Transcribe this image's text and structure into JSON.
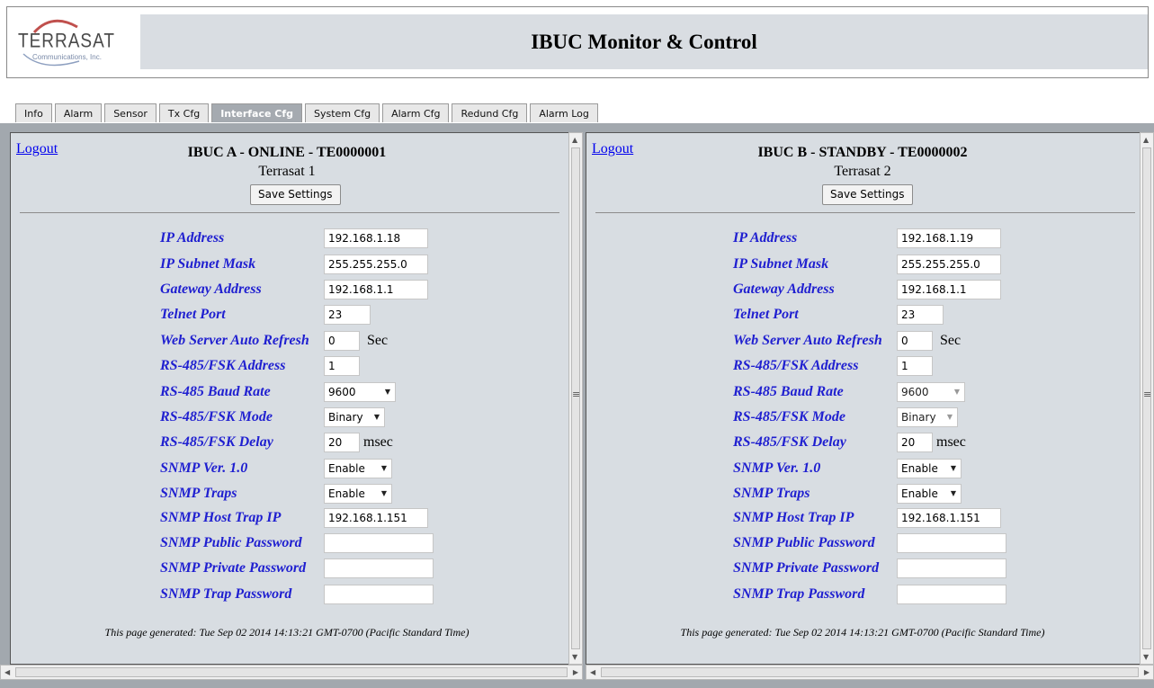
{
  "header": {
    "logo_name": "TERRASAT",
    "logo_sub": "Communications, Inc.",
    "title": "IBUC Monitor & Control"
  },
  "tabs": [
    {
      "label": "Info"
    },
    {
      "label": "Alarm"
    },
    {
      "label": "Sensor"
    },
    {
      "label": "Tx Cfg"
    },
    {
      "label": "Interface Cfg",
      "active": true
    },
    {
      "label": "System Cfg"
    },
    {
      "label": "Alarm Cfg"
    },
    {
      "label": "Redund Cfg"
    },
    {
      "label": "Alarm Log"
    }
  ],
  "labels": {
    "ip": "IP Address",
    "mask": "IP Subnet Mask",
    "gateway": "Gateway Address",
    "telnet": "Telnet Port",
    "refresh": "Web Server Auto Refresh",
    "rs485_addr": "RS-485/FSK Address",
    "baud": "RS-485 Baud Rate",
    "mode": "RS-485/FSK Mode",
    "delay": "RS-485/FSK Delay",
    "snmp_ver": "SNMP Ver. 1.0",
    "traps": "SNMP Traps",
    "host_trap": "SNMP Host Trap IP",
    "public_pw": "SNMP Public Password",
    "private_pw": "SNMP Private Password",
    "trap_pw": "SNMP Trap Password",
    "sec": "Sec",
    "msec": "msec"
  },
  "panels": [
    {
      "logout": "Logout",
      "title": "IBUC A - ONLINE - TE0000001",
      "name": "Terrasat 1",
      "save": "Save Settings",
      "ip": "192.168.1.18",
      "mask": "255.255.255.0",
      "gateway": "192.168.1.1",
      "telnet": "23",
      "refresh": "0",
      "rs485_addr": "1",
      "baud": "9600",
      "mode": "Binary",
      "delay": "20",
      "snmp_ver": "Enable",
      "traps": "Enable",
      "host_trap": "192.168.1.151",
      "public_pw": "",
      "private_pw": "",
      "trap_pw": "",
      "footer": "This page generated: Tue Sep 02 2014 14:13:21 GMT-0700 (Pacific Standard Time)"
    },
    {
      "logout": "Logout",
      "title": "IBUC B - STANDBY - TE0000002",
      "name": "Terrasat 2",
      "save": "Save Settings",
      "ip": "192.168.1.19",
      "mask": "255.255.255.0",
      "gateway": "192.168.1.1",
      "telnet": "23",
      "refresh": "0",
      "rs485_addr": "1",
      "baud": "9600",
      "mode": "Binary",
      "delay": "20",
      "snmp_ver": "Enable",
      "traps": "Enable",
      "host_trap": "192.168.1.151",
      "public_pw": "",
      "private_pw": "",
      "trap_pw": "",
      "footer": "This page generated: Tue Sep 02 2014 14:13:21 GMT-0700 (Pacific Standard Time)"
    }
  ],
  "icons": {
    "up": "▲",
    "down": "▼",
    "left": "◀",
    "right": "▶",
    "grip": "≡",
    "caret": "▼"
  }
}
